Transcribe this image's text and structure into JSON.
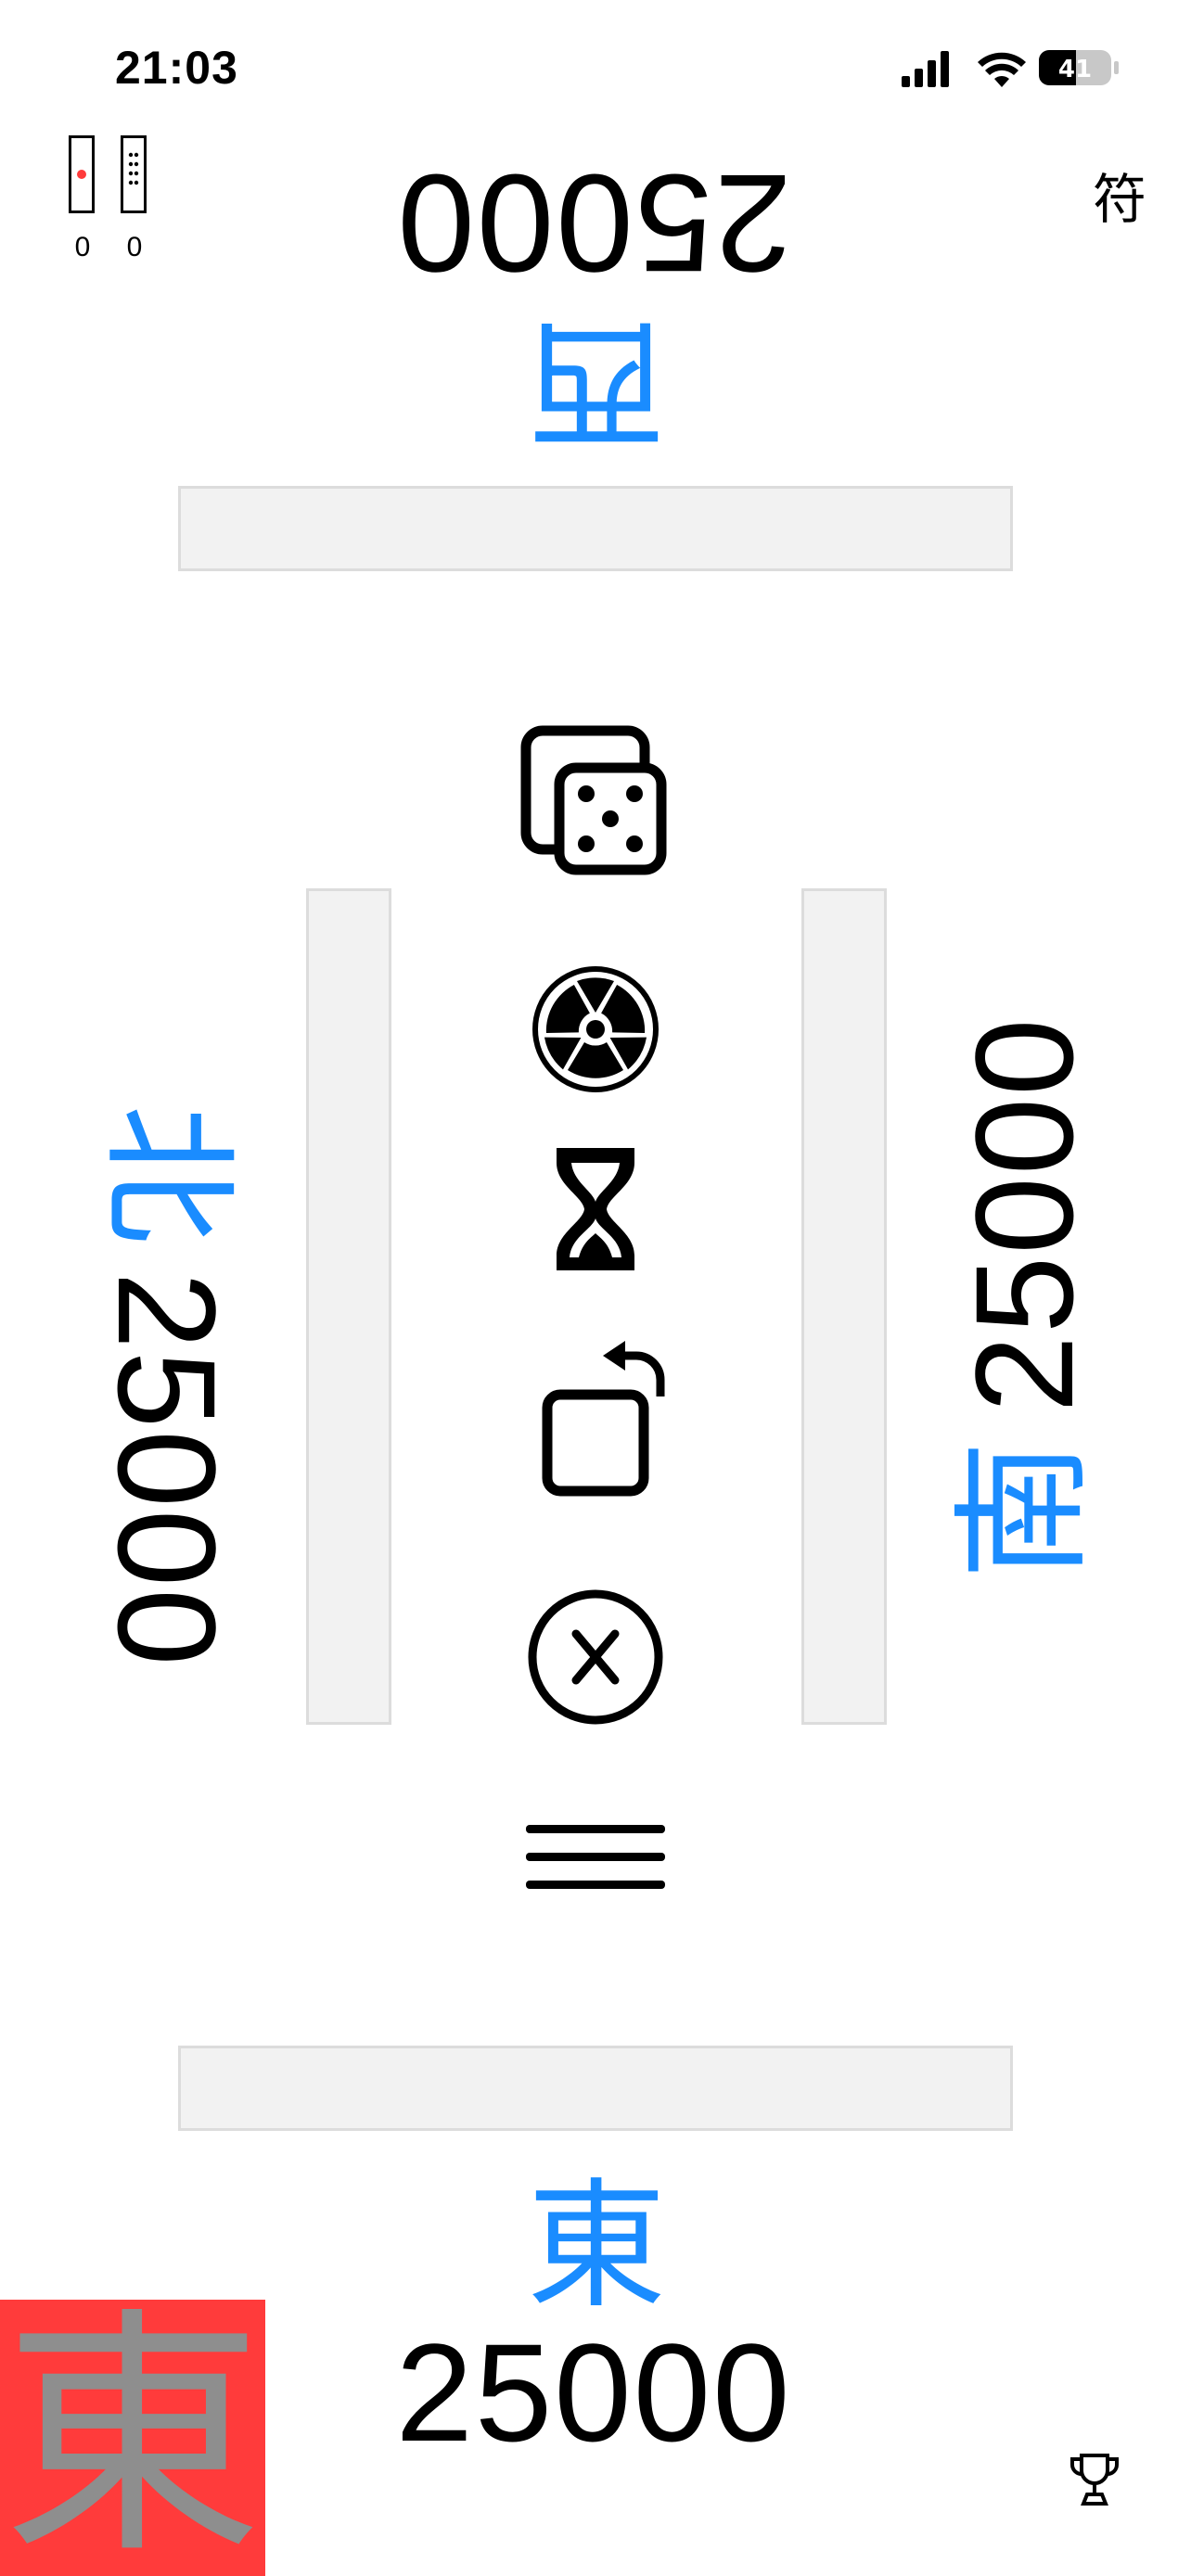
{
  "status_bar": {
    "time": "21:03",
    "battery": "41",
    "icons": [
      "signal-bars-icon",
      "wifi-icon",
      "battery-icon"
    ]
  },
  "counters": {
    "riichi_count": "0",
    "honba_count": "0",
    "icons": [
      "riichi-stick-icon",
      "honba-stick-icon"
    ]
  },
  "fu_label": "符",
  "players": {
    "top": {
      "wind": "西",
      "score": "25000"
    },
    "left": {
      "wind": "北",
      "score": "25000"
    },
    "right": {
      "wind": "南",
      "score": "25000"
    },
    "bottom": {
      "wind": "東",
      "score": "25000"
    }
  },
  "center_icons": [
    "dice-icon",
    "radiation-icon",
    "hourglass-icon",
    "rotate-icon",
    "close-circle-icon",
    "menu-icon"
  ],
  "dealer_badge": "東",
  "colors": {
    "wind_blue": "#1a8cff",
    "dealer_red": "#ff3b3b",
    "dealer_text_gray": "#8e8e8e",
    "bar_fill": "#f2f2f2",
    "bar_border": "#dcdcdc"
  },
  "trophy_icon": "trophy-icon"
}
